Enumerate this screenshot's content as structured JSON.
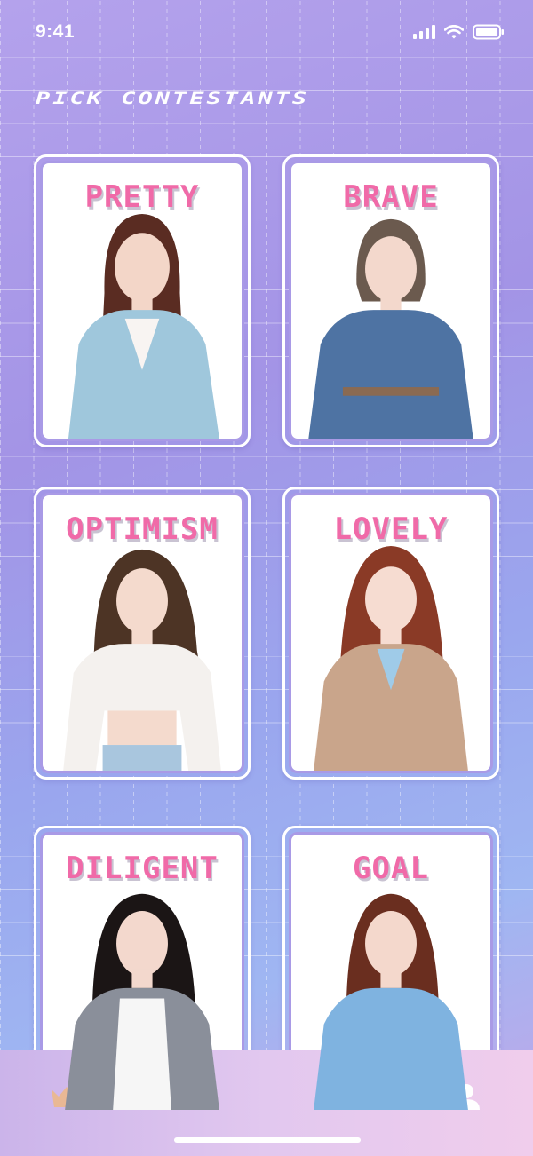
{
  "status_bar": {
    "time": "9:41"
  },
  "header": {
    "title": "PICK CONTESTANTS"
  },
  "contestants": [
    {
      "label": "PRETTY",
      "hair": "#5a2c22",
      "top": "#9fc7dc",
      "skin": "#f3d6c8"
    },
    {
      "label": "BRAVE",
      "hair": "#6b5a4e",
      "top": "#4e73a3",
      "skin": "#f3d8cc"
    },
    {
      "label": "OPTIMISM",
      "hair": "#4d3425",
      "top": "#f4f1ee",
      "skin": "#f4dacd"
    },
    {
      "label": "LOVELY",
      "hair": "#8a3a26",
      "top": "#c9a58b",
      "skin": "#f6dcd1"
    },
    {
      "label": "DILIGENT",
      "hair": "#1b1515",
      "top": "#8a8f9a",
      "skin": "#f3d8cd"
    },
    {
      "label": "GOAL",
      "hair": "#6a2e1f",
      "top": "#7fb3e0",
      "skin": "#f4d8cc"
    }
  ],
  "tabs": [
    {
      "name": "crown-icon",
      "color": "#e9b894"
    },
    {
      "name": "group-icon",
      "color": "#ffffff"
    },
    {
      "name": "chat-icon",
      "color": "#ffffff"
    },
    {
      "name": "profile-icon",
      "color": "#ffffff"
    }
  ],
  "colors": {
    "label": "#f06aa8",
    "card_border": "#a99ae6"
  }
}
